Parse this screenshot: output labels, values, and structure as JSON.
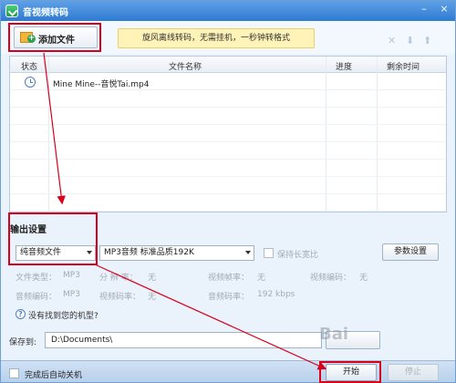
{
  "window": {
    "title": "音视频转码",
    "minimize_glyph": "–",
    "close_glyph": "×"
  },
  "toolbar": {
    "add_file_label": "添加文件",
    "promo_text": "旋风离线转码，无需挂机，一秒钟转格式",
    "icons": [
      "delete-icon",
      "move-down-icon",
      "move-up-icon"
    ]
  },
  "table": {
    "columns": [
      "状态",
      "文件名称",
      "进度",
      "剩余时间"
    ],
    "rows": [
      {
        "status_icon": "clock-icon",
        "name": "Mine Mine--音悦Tai.mp4",
        "progress": "",
        "remaining": ""
      }
    ]
  },
  "output": {
    "title": "输出设置",
    "format_selected": "纯音频文件",
    "quality_selected": "MP3音频 标准品质192K",
    "keep_ratio_label": "保持长宽比",
    "param_button": "参数设置",
    "info": {
      "file_type_label": "文件类型：",
      "file_type_value": "MP3",
      "resolution_label": "分 辨 率：",
      "resolution_value": "无",
      "video_fps_label": "视频帧率：",
      "video_fps_value": "无",
      "video_codec_label": "视频编码：",
      "video_codec_value": "无",
      "audio_codec_label": "音频编码：",
      "audio_codec_value": "MP3",
      "video_bitrate_label": "视频码率：",
      "video_bitrate_value": "无",
      "audio_bitrate_label": "音频码率：",
      "audio_bitrate_value": "192 kbps"
    },
    "help_link": "没有找到您的机型?",
    "save_label": "保存到:",
    "save_path": "D:\\Documents\\"
  },
  "footer": {
    "shutdown_label": "完成后自动关机",
    "start_button": "开始",
    "stop_button": "停止"
  },
  "watermark": "Bai",
  "colors": {
    "title_bar": "#2f7bd2",
    "annotation_red": "#d8001a",
    "promo_bg": "#fff3b8"
  }
}
